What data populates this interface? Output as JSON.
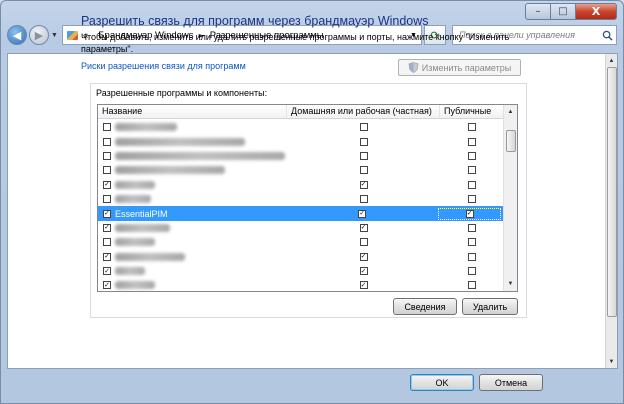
{
  "window": {
    "caption_buttons": {
      "minimize": "–",
      "maximize": "□",
      "close": "X"
    }
  },
  "navigation": {
    "back_icon": "back-arrow-icon",
    "forward_icon": "forward-arrow-icon",
    "breadcrumb": {
      "prefix": "«",
      "items": [
        "Брандмауэр Windows",
        "Разрешенные программы"
      ],
      "separator": "►"
    },
    "refresh_icon": "refresh-icon",
    "search_placeholder": "Поиск в панели управления"
  },
  "page": {
    "title": "Разрешить связь для программ через брандмауэр Windows",
    "description": "Чтобы добавить, изменить или удалить разрешенные программы и порты, нажмите кнопку \"Изменить параметры\".",
    "risk_link": "Риски разрешения связи для программ",
    "change_settings_label": "Изменить параметры",
    "group_label": "Разрешенные программы и компоненты:",
    "columns": {
      "name": "Название",
      "home": "Домашняя или рабочая (частная)",
      "public": "Публичные"
    },
    "rows": [
      {
        "name": "",
        "enabled": false,
        "home": false,
        "public": false
      },
      {
        "name": "",
        "enabled": false,
        "home": false,
        "public": false
      },
      {
        "name": "",
        "enabled": false,
        "home": false,
        "public": false
      },
      {
        "name": "",
        "enabled": false,
        "home": false,
        "public": false
      },
      {
        "name": "",
        "enabled": true,
        "home": true,
        "public": false
      },
      {
        "name": "",
        "enabled": false,
        "home": false,
        "public": false
      },
      {
        "name": "EssentialPIM",
        "enabled": true,
        "home": true,
        "public": true,
        "selected": true
      },
      {
        "name": "",
        "enabled": true,
        "home": true,
        "public": false
      },
      {
        "name": "",
        "enabled": false,
        "home": false,
        "public": false
      },
      {
        "name": "",
        "enabled": true,
        "home": true,
        "public": false
      },
      {
        "name": "",
        "enabled": true,
        "home": true,
        "public": false
      },
      {
        "name": "",
        "enabled": true,
        "home": true,
        "public": false
      },
      {
        "name": "",
        "enabled": true,
        "home": true,
        "public": false
      }
    ],
    "details_button": "Сведения",
    "remove_button": "Удалить"
  },
  "footer": {
    "ok_button": "OK",
    "cancel_button": "Отмена"
  }
}
